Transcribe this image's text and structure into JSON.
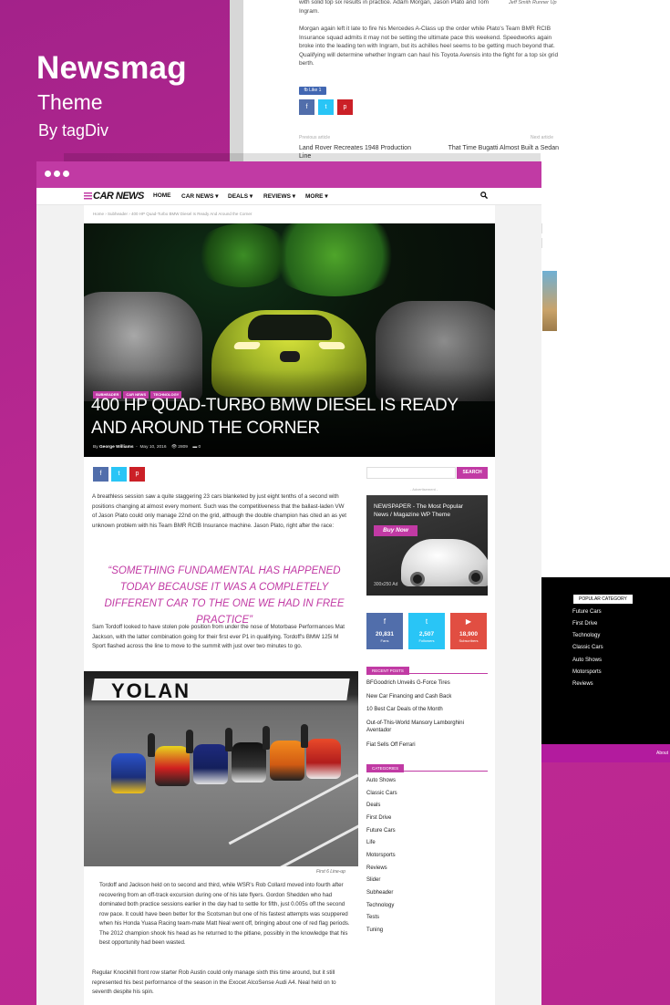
{
  "brand": {
    "title": "Newsmag",
    "subtitle": "Theme",
    "byline": "By tagDiv"
  },
  "back_page": {
    "caption": "Jeff Smith Runner Up",
    "paragraph_top": "with solid top six results in practice. Adam Morgan, Jason Plato and Tom Ingram.",
    "paragraph": "Morgan again left it late to fire his Mercedes A-Class up the order while Plato's Team BMR RCIB Insurance squad admits it may not be setting the ultimate pace this weekend. Speedworks again broke into the leading ten with Ingram, but its achilles heel seems to be getting much beyond that. Qualifying will determine whether Ingram can haul his Toyota Avensis into the fight for a top six grid berth.",
    "like_label": "fb Like 1",
    "prev_label": "Previous article",
    "prev_title": "Land Rover Recreates 1948 Production Line",
    "next_label": "Next article",
    "next_title": "That Time Bugatti Almost Built a Sedan",
    "side_btn_1": "ON MOS",
    "side_btn_2": "BUY",
    "footer_heading": "POPULAR CATEGORY",
    "footer_items": [
      "Future Cars",
      "First Drive",
      "Technology",
      "Classic Cars",
      "Auto Shows",
      "Motorsports",
      "Reviews"
    ],
    "footer_about": "About"
  },
  "nav": {
    "logo": "CAR NEWS",
    "items": [
      "HOME",
      "CAR NEWS",
      "DEALS",
      "REVIEWS",
      "MORE"
    ]
  },
  "breadcrumb": "Home  ›  Subheader  ›  400 HP Quad-Turbo BMW Diesel Is Ready And Around the Corner",
  "article": {
    "tags": [
      "SUBHEADER",
      "CAR NEWS",
      "TECHNOLOGY"
    ],
    "title": "400 HP QUAD-TURBO BMW DIESEL IS READY AND AROUND THE CORNER",
    "by": "By",
    "author": "George Williams",
    "date": "May 10, 2016",
    "views": "2809",
    "comments": "0",
    "para1": "A breathless session saw a quite staggering 23 cars blanketed by just eight tenths of a second with positions changing at almost every moment. Such was the competitiveness that the ballast-laden VW of Jason Plato could only manage 22nd on the grid, although the double champion has cited an as yet unknown problem with his Team BMR RCIB Insurance machine. Jason Plato, right after the race:",
    "quote": "“SOMETHING FUNDAMENTAL HAS HAPPENED TODAY BECAUSE IT WAS A COMPLETELY DIFFERENT CAR TO THE ONE WE HAD IN FREE PRACTICE”",
    "para2": "Sam Tordoff looked to have stolen pole position from under the nose of Motorbase Performances Mat Jackson, with the latter combination going for their first ever P1 in qualifying. Tordoff's BMW 125i M Sport flashed across the line to move to the summit with just over two minutes to go.",
    "photo_banner": "YOLAN",
    "photo_caption": "First 6 Line-up",
    "para3": "Tordoff and Jackson held on to second and third, while WSR's Rob Collard moved into fourth after recovering from an off-track excursion during one of his late flyers. Gordon Shedden who had dominated both practice sessions earlier in the day had to settle for fifth, just 0.005s off the second row pace. It could have been better for the Scotsman but one of his fastest attempts was scuppered when his Honda Yuasa Racing team-mate Matt Neal went off, bringing about one of red flag periods. The 2012 champion shook his head as he returned to the pitlane, possibly in the knowledge that his best opportunity had been wasted.",
    "para4": "Regular Knockhill front row starter Rob Austin could only manage sixth this time around, but it still represented his best performance of the season in the Exocet AlcoSense Audi A4. Neal held on to seventh despite his spin."
  },
  "sidebar": {
    "search_button": "SEARCH",
    "ad_label": "- Advertisement -",
    "ad_title": "NEWSPAPER - The Most Popular News / Magazine WP Theme",
    "ad_button": "Buy Now",
    "ad_size": "300x250 Ad",
    "social": [
      {
        "icon": "f",
        "count": "20,831",
        "label": "Fans",
        "color": "#516eab"
      },
      {
        "icon": "t",
        "count": "2,507",
        "label": "Followers",
        "color": "#29c5f6"
      },
      {
        "icon": "▶",
        "count": "18,900",
        "label": "Subscribers",
        "color": "#e14e42"
      }
    ],
    "recent_heading": "RECENT POSTS",
    "recent_posts": [
      "BFGoodrich Unveils G-Force Tires",
      "New Car Financing and Cash Back",
      "10 Best Car Deals of the Month",
      "Out-of-This-World Mansory Lamborghini Aventador",
      "Fiat Sells Off Ferrari"
    ],
    "categories_heading": "CATEGORIES",
    "categories": [
      "Auto Shows",
      "Classic Cars",
      "Deals",
      "First Drive",
      "Future Cars",
      "Life",
      "Motorsports",
      "Reviews",
      "Slider",
      "Subheader",
      "Technology",
      "Tests",
      "Tuning"
    ]
  },
  "colors": {
    "accent": "#c13aa4",
    "background": "#b5248f",
    "facebook": "#516eab",
    "twitter": "#29c5f6",
    "pinterest": "#cb2027"
  }
}
